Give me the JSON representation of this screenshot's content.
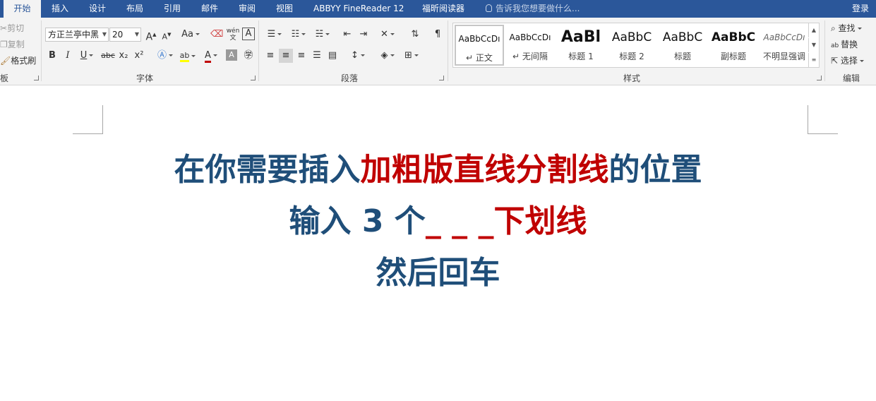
{
  "tabs": {
    "home": "开始",
    "insert": "插入",
    "design": "设计",
    "layout": "布局",
    "references": "引用",
    "mailings": "邮件",
    "review": "审阅",
    "view": "视图",
    "abbyy": "ABBYY FineReader 12",
    "foxit": "福昕阅读器"
  },
  "tell_me": {
    "placeholder": "告诉我您想要做什么..."
  },
  "sign_in": "登录",
  "clipboard": {
    "cut": "剪切",
    "copy": "复制",
    "format_painter": "格式刷",
    "label": "板"
  },
  "font": {
    "label": "字体",
    "font_name": "方正兰亭中黑",
    "font_size": "20",
    "change_case": "Aa",
    "bold": "B",
    "italic": "I",
    "underline": "U",
    "strike": "abc",
    "subscript": "x₂",
    "superscript": "x²",
    "grow": "A",
    "shrink": "A",
    "font_color_letter": "A",
    "highlight_text": "ab",
    "font_color": "#c00000",
    "highlight_color": "#ffff00"
  },
  "paragraph": {
    "label": "段落"
  },
  "styles": {
    "label": "样式",
    "items": [
      {
        "preview": "AaBbCcDı",
        "name": "正文"
      },
      {
        "preview": "AaBbCcDı",
        "name": "无间隔"
      },
      {
        "preview": "AaBl",
        "name": "标题 1"
      },
      {
        "preview": "AaBbC",
        "name": "标题 2"
      },
      {
        "preview": "AaBbC",
        "name": "标题"
      },
      {
        "preview": "AaBbC",
        "name": "副标题"
      },
      {
        "preview": "AaBbCcDı",
        "name": "不明显强调"
      }
    ]
  },
  "editing": {
    "label": "编辑",
    "find": "查找",
    "replace": "替换",
    "select": "选择"
  },
  "document": {
    "line1": {
      "a": "在你需要插入",
      "b": "加粗版直线分割线",
      "c": "的位置"
    },
    "line2": {
      "a": "输入 3 个",
      "b": "_ _ _下划线"
    },
    "line3": "然后回车",
    "text_color": "#1f4e79",
    "accent_color": "#c00000"
  }
}
